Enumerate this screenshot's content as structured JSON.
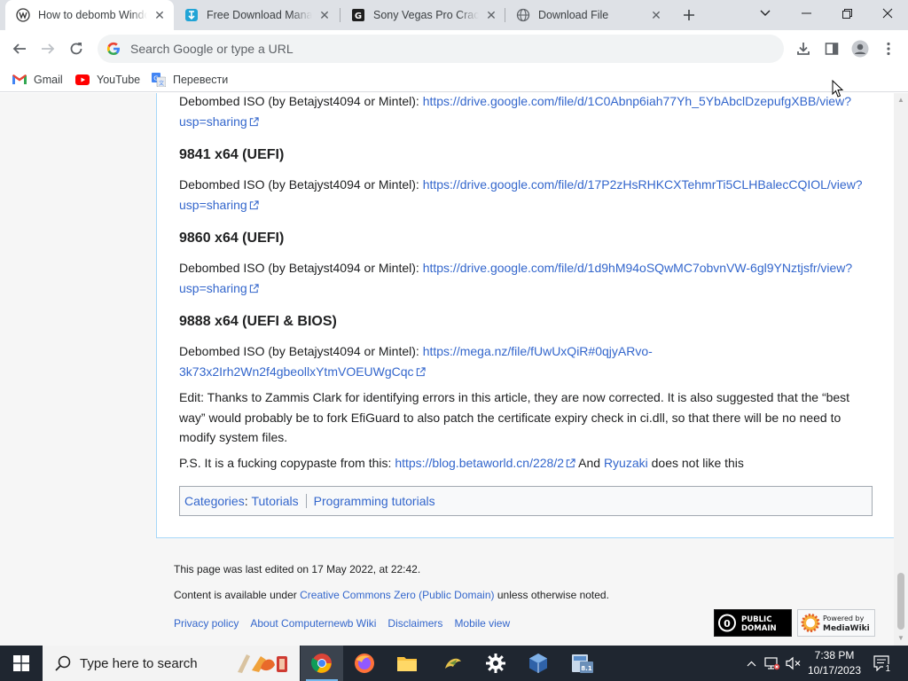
{
  "browser": {
    "tabs": [
      {
        "title": "How to debomb Windows",
        "active": true
      },
      {
        "title": "Free Download Manager",
        "active": false
      },
      {
        "title": "Sony Vegas Pro Crack",
        "active": false
      },
      {
        "title": "Download File",
        "active": false
      }
    ],
    "omnibox_placeholder": "Search Google or type a URL",
    "bookmarks": [
      {
        "label": "Gmail"
      },
      {
        "label": "YouTube"
      },
      {
        "label": "Перевести"
      }
    ]
  },
  "article": {
    "iso_label": "Debombed ISO (by Betajyst4094 or Mintel):",
    "block1": {
      "link_line1": "https://drive.google.com/file/d/1C0Abnp6iah77Yh_5YbAbclDzepufgXBB/view?",
      "link_line2": "usp=sharing"
    },
    "block2": {
      "heading": "9841 x64 (UEFI)",
      "link_line1": "https://drive.google.com/file/d/17P2zHsRHKCXTehmrTi5CLHBalecCQIOL/view?",
      "link_line2": "usp=sharing"
    },
    "block3": {
      "heading": "9860 x64 (UEFI)",
      "link_line1": "https://drive.google.com/file/d/1d9hM94oSQwMC7obvnVW-6gl9YNztjsfr/view?",
      "link_line2": "usp=sharing"
    },
    "block4": {
      "heading": "9888 x64 (UEFI & BIOS)",
      "link_line1": "https://mega.nz/file/fUwUxQiR#0qjyARvo-",
      "link_line2": "3k73x2Irh2Wn2f4gbeollxYtmVOEUWgCqc"
    },
    "edit_line1": "Edit: Thanks to Zammis Clark for identifying errors in this article, they are now corrected. It is also suggested that the “best",
    "edit_line2": "way” would probably be to fork EfiGuard to also patch the certificate expiry check in ci.dll, so that there will be no need to",
    "edit_line3": "modify system files.",
    "ps_prefix": "P.S. It is a fucking copypaste from this:",
    "ps_link": "https://blog.betaworld.cn/228/2",
    "ps_and": "And",
    "ps_user": "Ryuzaki",
    "ps_suffix": "does not like this",
    "categories_label": "Categories",
    "categories": [
      "Tutorials",
      "Programming tutorials"
    ]
  },
  "footer": {
    "last_edited": "This page was last edited on 17 May 2022, at 22:42.",
    "license_prefix": "Content is available under",
    "license_link": "Creative Commons Zero (Public Domain)",
    "license_suffix": "unless otherwise noted.",
    "links": [
      "Privacy policy",
      "About Computernewb Wiki",
      "Disclaimers",
      "Mobile view"
    ],
    "badge_public_domain_line1": "PUBLIC",
    "badge_public_domain_line2": "DOMAIN",
    "badge_mediawiki_line1": "Powered by",
    "badge_mediawiki_line2": "MediaWiki"
  },
  "taskbar": {
    "search_placeholder": "Type here to search",
    "time": "7:38 PM",
    "date": "10/17/2023",
    "notification_count": "1"
  }
}
